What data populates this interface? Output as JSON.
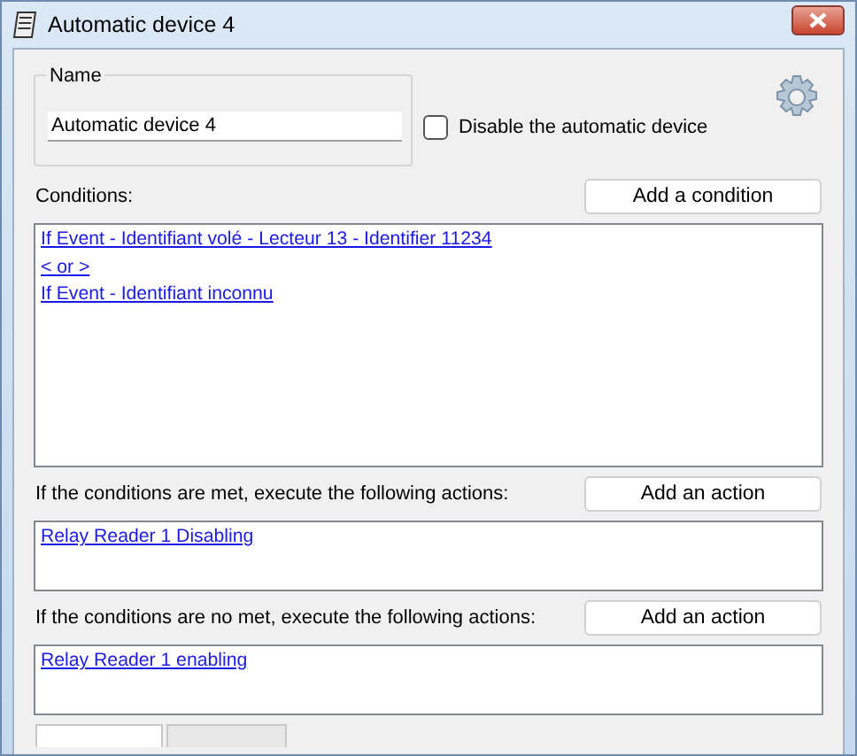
{
  "window": {
    "title": "Automatic device 4"
  },
  "name_group": {
    "legend": "Name",
    "value": "Automatic device 4"
  },
  "disable_checkbox": {
    "label": "Disable the automatic device",
    "checked": false
  },
  "sections": [
    {
      "label": "Conditions:",
      "button": "Add a condition",
      "items": [
        {
          "text": "If Event - Identifiant volé - Lecteur 13 - Identifier 11234"
        },
        {
          "text": "< or >"
        },
        {
          "text": "If Event - Identifiant inconnu"
        }
      ]
    },
    {
      "label": "If the conditions are met, execute the following actions:",
      "button": "Add an action",
      "items": [
        {
          "text": "Relay Reader 1 Disabling"
        }
      ]
    },
    {
      "label": "If the conditions are no met, execute the following actions:",
      "button": "Add an action",
      "items": [
        {
          "text": "Relay Reader 1 enabling"
        }
      ]
    }
  ],
  "bottom_tabs": [
    {
      "selected": true
    },
    {
      "selected": false
    }
  ]
}
